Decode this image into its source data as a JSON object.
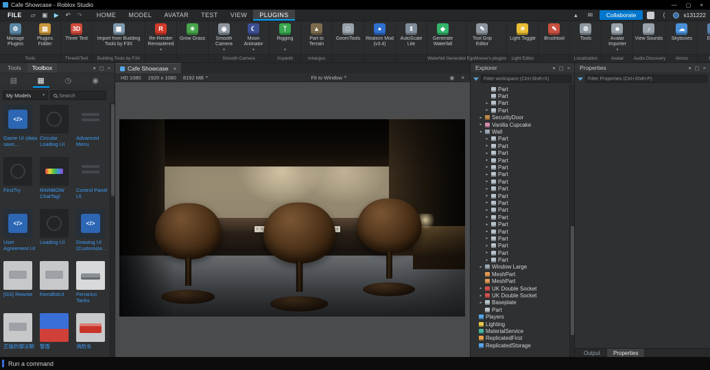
{
  "title_bar": {
    "title": "Cafe Showcase - Roblox Studio"
  },
  "icons": {
    "minimize": "—",
    "maximize": "▢",
    "close": "×",
    "collapse": "▴",
    "chat": "✉",
    "share": "⟨",
    "dropdown": "▾",
    "float": "▢",
    "record": "◉"
  },
  "menu": {
    "file_label": "FILE",
    "quick_icons": [
      {
        "name": "new-file-icon",
        "glyph": "▱"
      },
      {
        "name": "save-icon",
        "glyph": "▣"
      },
      {
        "name": "play-icon",
        "glyph": "▶",
        "color": "#8fd8f8"
      },
      {
        "name": "undo-icon",
        "glyph": "↶"
      },
      {
        "name": "redo-icon",
        "glyph": "↷",
        "color": "#6e7478"
      }
    ],
    "tabs": [
      {
        "label": "HOME"
      },
      {
        "label": "MODEL"
      },
      {
        "label": "AVATAR"
      },
      {
        "label": "TEST"
      },
      {
        "label": "VIEW"
      },
      {
        "label": "PLUGINS",
        "active": true
      }
    ],
    "collaborate_label": "Collaborate",
    "username": "s131222"
  },
  "ribbon": {
    "groups": [
      {
        "label": "Tools",
        "buttons": [
          {
            "label": "Manage Plugins",
            "glyph": "⚙",
            "color": "#5b87a6"
          },
          {
            "label": "Plugins Folder",
            "glyph": "▤",
            "color": "#c9973f"
          }
        ]
      },
      {
        "label": "ThreeDText",
        "buttons": [
          {
            "label": "Three Text",
            "glyph": "3D",
            "color": "#cf4a3a"
          }
        ]
      },
      {
        "label": "Building Tools by F3X",
        "buttons": [
          {
            "label": "Import from Building Tools by F3X",
            "glyph": "▦",
            "color": "#7f99ad",
            "wide": true
          }
        ]
      },
      {
        "label": "",
        "buttons": [
          {
            "label": "Re-Render Remastered",
            "glyph": "R",
            "color": "#d03a2a",
            "dropdown": true
          }
        ]
      },
      {
        "label": "",
        "buttons": [
          {
            "label": "Grow Grass",
            "glyph": "✳",
            "color": "#46a34b"
          }
        ]
      },
      {
        "label": "Smooth Camera",
        "buttons": [
          {
            "label": "Smooth Camera",
            "glyph": "◉",
            "color": "#8d969e",
            "dropdown": true
          },
          {
            "label": "Moon Animator",
            "glyph": "☾",
            "color": "#3d4f93",
            "dropdown": true
          }
        ]
      },
      {
        "label": "Xsyanth",
        "buttons": [
          {
            "label": "Rigging",
            "glyph": "ᛉ",
            "color": "#3aa84f",
            "dropdown": true
          }
        ]
      },
      {
        "label": "mkargus",
        "buttons": [
          {
            "label": "Part to Terrain",
            "glyph": "▲",
            "color": "#7d6b4e"
          }
        ]
      },
      {
        "label": "",
        "buttons": [
          {
            "label": "GeomTools",
            "glyph": "□",
            "color": "#97a1aa"
          }
        ]
      },
      {
        "label": "",
        "buttons": [
          {
            "label": "Realism Mod (v3.4)",
            "glyph": "●",
            "color": "#2f6fd0"
          }
        ]
      },
      {
        "label": "",
        "buttons": [
          {
            "label": "AutoScale Lite",
            "glyph": "⇕",
            "color": "#7f8c99"
          }
        ]
      },
      {
        "label": "Waterfall Generator",
        "buttons": [
          {
            "label": "Generate Waterfall",
            "glyph": "◆",
            "color": "#35b56a"
          }
        ]
      },
      {
        "label": "EgoMoose's plugins",
        "buttons": [
          {
            "label": "Tool Grip Editor",
            "glyph": "✎",
            "color": "#8c959d"
          }
        ]
      },
      {
        "label": "Light Editor",
        "buttons": [
          {
            "label": "Light Toggle",
            "glyph": "☀",
            "color": "#e8bd33"
          }
        ]
      },
      {
        "label": "",
        "buttons": [
          {
            "label": "Brushtool",
            "glyph": "✎",
            "color": "#c8503f"
          }
        ]
      },
      {
        "label": "Localization",
        "buttons": [
          {
            "label": "Tools",
            "glyph": "⚙",
            "color": "#8f99a2"
          }
        ]
      },
      {
        "label": "Avatar",
        "buttons": [
          {
            "label": "Avatar Importer",
            "glyph": "☻",
            "color": "#98a2ab",
            "dropdown": true
          }
        ]
      },
      {
        "label": "Audio Discovery",
        "buttons": [
          {
            "label": "View Sounds",
            "glyph": "♪",
            "color": "#98a2ab"
          }
        ]
      },
      {
        "label": "Atmos",
        "buttons": [
          {
            "label": "Skyboxes",
            "glyph": "☁",
            "color": "#4a90d9"
          }
        ]
      },
      {
        "label": "Rain",
        "buttons": [
          {
            "label": "Editor",
            "glyph": "☂",
            "color": "#5a7fae"
          }
        ]
      }
    ]
  },
  "toolbox": {
    "tab_tools": "Tools",
    "tab_toolbox": "Toolbox",
    "tabs": [
      {
        "name": "marketplace",
        "glyph": "▤"
      },
      {
        "name": "inventory",
        "glyph": "▦",
        "active": true
      },
      {
        "name": "recent",
        "glyph": "◷"
      },
      {
        "name": "creations",
        "glyph": "◉"
      }
    ],
    "category": "My Models",
    "search_placeholder": "Search",
    "items": [
      {
        "label": "Game UI (data save,...",
        "thumb": "blueui"
      },
      {
        "label": "Circular Loading UI",
        "thumb": "dark"
      },
      {
        "label": "Advanced Menu",
        "thumb": "dark2"
      },
      {
        "label": "FirstTry",
        "thumb": "dark"
      },
      {
        "label": "RAINBOW ChatTag!",
        "thumb": "rainbow"
      },
      {
        "label": "Control Panel UI",
        "thumb": "dark2"
      },
      {
        "label": "User Agreement UI",
        "thumb": "blueui"
      },
      {
        "label": "Loading UI",
        "thumb": "dark"
      },
      {
        "label": "Drawing UI (Customize...",
        "thumb": "blueui"
      },
      {
        "label": "[GS] Rewrite",
        "thumb": "light"
      },
      {
        "label": "friendlistUI",
        "thumb": "light"
      },
      {
        "label": "Ferrarico Tanks",
        "thumb": "tank"
      },
      {
        "label": "正版防御法聊",
        "thumb": "light"
      },
      {
        "label": "警盾",
        "thumb": "badge"
      },
      {
        "label": "消防车",
        "thumb": "truck"
      }
    ]
  },
  "viewport": {
    "tab_label": "Cafe Showcase",
    "resolution_label": "HD 1080",
    "resolution": "1920 x 1080",
    "memory": "8192 MB",
    "fit_label": "Fit to Window"
  },
  "explorer": {
    "title": "Explorer",
    "filter_placeholder": "Filter workspace (Ctrl+Shift+X)",
    "icon_colors": {
      "part": "#b9c3cb",
      "door": "#c08a4a",
      "cupcake": "#d58ab0",
      "model": "#9aa7b3",
      "mesh": "#e09a57",
      "socket": "#d05050",
      "players": "#58a6e8",
      "lighting": "#e8c84a",
      "material": "#45b8a5",
      "repfirst": "#e8a04a",
      "repstorage": "#58a6e8"
    },
    "items": [
      {
        "label": "Part",
        "icon": "part",
        "indent": 2,
        "arrow": ""
      },
      {
        "label": "Part",
        "icon": "part",
        "indent": 2,
        "arrow": ""
      },
      {
        "label": "Part",
        "icon": "part",
        "indent": 2,
        "arrow": "r"
      },
      {
        "label": "Part",
        "icon": "part",
        "indent": 2,
        "arrow": "r"
      },
      {
        "label": "SecurityDoor",
        "icon": "door",
        "indent": 1,
        "arrow": "r"
      },
      {
        "label": "Vanilla Cupcake",
        "icon": "cupcake",
        "indent": 1,
        "arrow": "r"
      },
      {
        "label": "Wall",
        "icon": "model",
        "indent": 1,
        "arrow": "d"
      },
      {
        "label": "Part",
        "icon": "part",
        "indent": 2,
        "arrow": "r"
      },
      {
        "label": "Part",
        "icon": "part",
        "indent": 2,
        "arrow": "r"
      },
      {
        "label": "Part",
        "icon": "part",
        "indent": 2,
        "arrow": "r"
      },
      {
        "label": "Part",
        "icon": "part",
        "indent": 2,
        "arrow": "r"
      },
      {
        "label": "Part",
        "icon": "part",
        "indent": 2,
        "arrow": "r"
      },
      {
        "label": "Part",
        "icon": "part",
        "indent": 2,
        "arrow": "r"
      },
      {
        "label": "Part",
        "icon": "part",
        "indent": 2,
        "arrow": "r"
      },
      {
        "label": "Part",
        "icon": "part",
        "indent": 2,
        "arrow": "r"
      },
      {
        "label": "Part",
        "icon": "part",
        "indent": 2,
        "arrow": "r"
      },
      {
        "label": "Part",
        "icon": "part",
        "indent": 2,
        "arrow": "r"
      },
      {
        "label": "Part",
        "icon": "part",
        "indent": 2,
        "arrow": "r"
      },
      {
        "label": "Part",
        "icon": "part",
        "indent": 2,
        "arrow": "r"
      },
      {
        "label": "Part",
        "icon": "part",
        "indent": 2,
        "arrow": "r"
      },
      {
        "label": "Part",
        "icon": "part",
        "indent": 2,
        "arrow": "r"
      },
      {
        "label": "Part",
        "icon": "part",
        "indent": 2,
        "arrow": "r"
      },
      {
        "label": "Part",
        "icon": "part",
        "indent": 2,
        "arrow": "r"
      },
      {
        "label": "Part",
        "icon": "part",
        "indent": 2,
        "arrow": "r"
      },
      {
        "label": "Part",
        "icon": "part",
        "indent": 2,
        "arrow": "r"
      },
      {
        "label": "Window Large",
        "icon": "model",
        "indent": 1,
        "arrow": "r"
      },
      {
        "label": "MeshPart",
        "icon": "mesh",
        "indent": 1,
        "arrow": ""
      },
      {
        "label": "MeshPart",
        "icon": "mesh",
        "indent": 1,
        "arrow": ""
      },
      {
        "label": "UK Double Socket",
        "icon": "socket",
        "indent": 1,
        "arrow": "r"
      },
      {
        "label": "UK Double Socket",
        "icon": "socket",
        "indent": 1,
        "arrow": "r"
      },
      {
        "label": "Baseplate",
        "icon": "part",
        "indent": 1,
        "arrow": "r"
      },
      {
        "label": "Part",
        "icon": "part",
        "indent": 1,
        "arrow": ""
      },
      {
        "label": "Players",
        "icon": "players",
        "indent": 0,
        "arrow": ""
      },
      {
        "label": "Lighting",
        "icon": "lighting",
        "indent": 0,
        "arrow": ""
      },
      {
        "label": "MaterialService",
        "icon": "material",
        "indent": 0,
        "arrow": ""
      },
      {
        "label": "ReplicatedFirst",
        "icon": "repfirst",
        "indent": 0,
        "arrow": ""
      },
      {
        "label": "ReplicatedStorage",
        "icon": "repstorage",
        "indent": 0,
        "arrow": ""
      }
    ]
  },
  "properties": {
    "title": "Properties",
    "filter_placeholder": "Filter Properties (Ctrl+Shift+P)"
  },
  "bottom_tabs": {
    "output": "Output",
    "properties": "Properties"
  },
  "status_bar": {
    "command_placeholder": "Run a command"
  }
}
